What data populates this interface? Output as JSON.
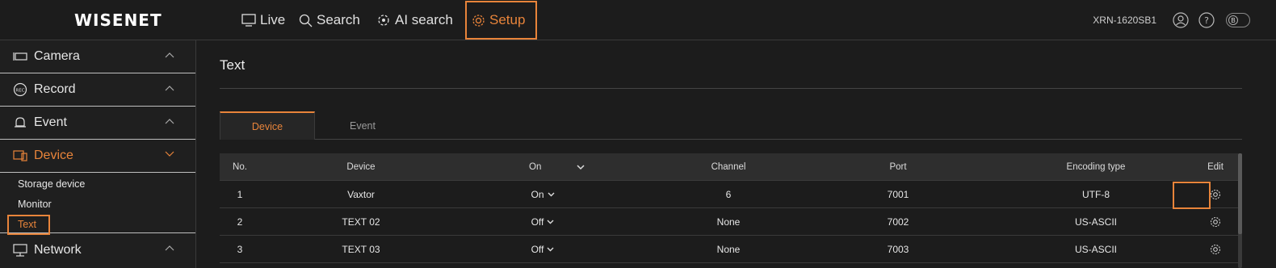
{
  "brand": {
    "logo": "WISENET",
    "accent": "#e8843a"
  },
  "topnav": {
    "items": [
      {
        "label": "Live",
        "icon": "monitor-icon"
      },
      {
        "label": "Search",
        "icon": "search-icon"
      },
      {
        "label": "AI search",
        "icon": "ai-search-icon"
      },
      {
        "label": "Setup",
        "icon": "gear-icon",
        "active": true
      }
    ],
    "model": "XRN-1620SB1",
    "toggle_label": "B"
  },
  "sidebar": {
    "sections": [
      {
        "label": "Camera",
        "icon": "camera-icon"
      },
      {
        "label": "Record",
        "icon": "rec-icon"
      },
      {
        "label": "Event",
        "icon": "bell-icon"
      },
      {
        "label": "Device",
        "icon": "device-icon",
        "active": true
      },
      {
        "label": "Network",
        "icon": "network-icon"
      }
    ],
    "device_sub": [
      "Storage device",
      "Monitor",
      "Text"
    ],
    "selected_sub": "Text"
  },
  "main": {
    "title": "Text",
    "tabs": [
      {
        "label": "Device",
        "active": true
      },
      {
        "label": "Event",
        "active": false
      }
    ],
    "table": {
      "headers": {
        "no": "No.",
        "device": "Device",
        "on": "On",
        "channel": "Channel",
        "port": "Port",
        "encoding": "Encoding type",
        "edit": "Edit"
      },
      "rows": [
        {
          "no": "1",
          "device": "Vaxtor",
          "on": "On",
          "channel": "6",
          "port": "7001",
          "encoding": "UTF-8"
        },
        {
          "no": "2",
          "device": "TEXT 02",
          "on": "Off",
          "channel": "None",
          "port": "7002",
          "encoding": "US-ASCII"
        },
        {
          "no": "3",
          "device": "TEXT 03",
          "on": "Off",
          "channel": "None",
          "port": "7003",
          "encoding": "US-ASCII"
        }
      ]
    }
  }
}
